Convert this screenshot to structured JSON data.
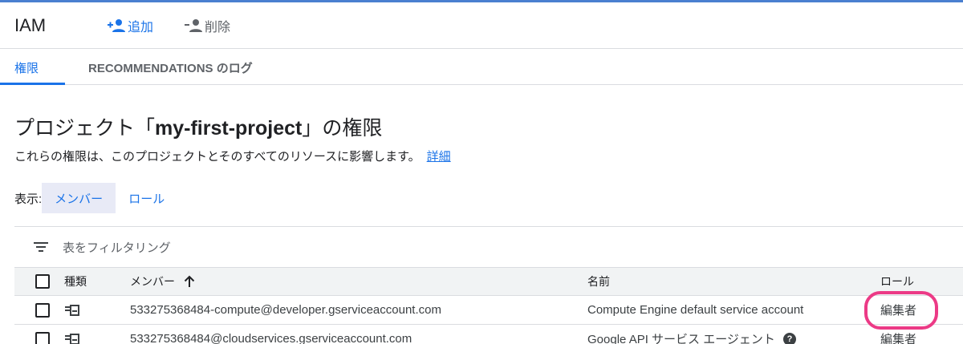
{
  "header": {
    "title": "IAM",
    "add_label": "追加",
    "delete_label": "削除"
  },
  "tabs": [
    {
      "label": "権限",
      "active": true
    },
    {
      "label": "RECOMMENDATIONS のログ",
      "active": false
    }
  ],
  "page": {
    "title_prefix": "プロジェクト「",
    "project_id": "my-first-project",
    "title_suffix": "」の権限",
    "description": "これらの権限は、このプロジェクトとそのすべてのリソースに影響します。",
    "details_link": "詳細"
  },
  "view_as": {
    "label": "表示:",
    "options": [
      {
        "label": "メンバー",
        "selected": true
      },
      {
        "label": "ロール",
        "selected": false
      }
    ]
  },
  "table": {
    "filter_placeholder": "表をフィルタリング",
    "columns": {
      "type": "種類",
      "member": "メンバー",
      "name": "名前",
      "role": "ロール"
    },
    "sort": {
      "column": "member",
      "direction": "ascending"
    },
    "rows": [
      {
        "type_icon": "service-account-icon",
        "member": "533275368484-compute@developer.gserviceaccount.com",
        "name": "Compute Engine default service account",
        "role": "編集者",
        "highlighted": true
      },
      {
        "type_icon": "service-account-icon",
        "member": "533275368484@cloudservices.gserviceaccount.com",
        "name": "Google API サービス エージェント",
        "help_icon": "?",
        "role": "編集者",
        "highlighted": false
      }
    ]
  },
  "colors": {
    "accent": "#1a73e8",
    "annotation": "#ec3a86",
    "top_bar": "#4a7fd0"
  }
}
